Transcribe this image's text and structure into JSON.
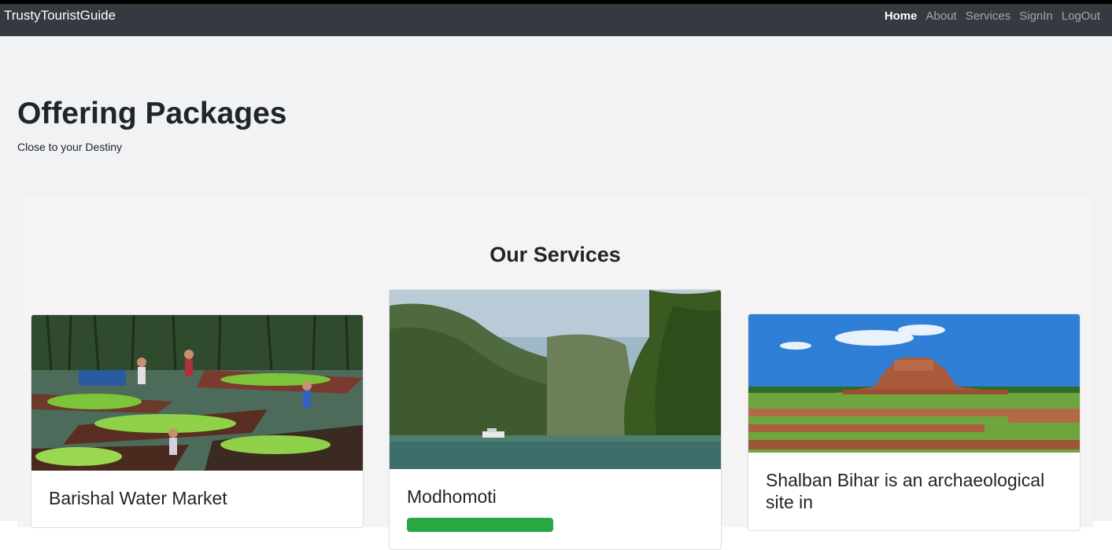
{
  "navbar": {
    "brand": "TrustyTouristGuide",
    "links": [
      "Home",
      "About",
      "Services",
      "SignIn",
      "LogOut"
    ],
    "active": "Home"
  },
  "hero": {
    "title": "Offering Packages",
    "subtitle": "Close to your Destiny"
  },
  "services": {
    "title": "Our Services",
    "cards": [
      {
        "title": "Barishal Water Market",
        "image": "floating-market-photo"
      },
      {
        "title": "Modhomoti",
        "image": "river-valley-photo"
      },
      {
        "title": "Shalban Bihar is an archaeological site in",
        "image": "ruins-photo"
      }
    ]
  },
  "colors": {
    "navbar_bg": "#343a40",
    "jumbotron_bg": "#f0f2f4",
    "accent_green": "#28a745"
  }
}
